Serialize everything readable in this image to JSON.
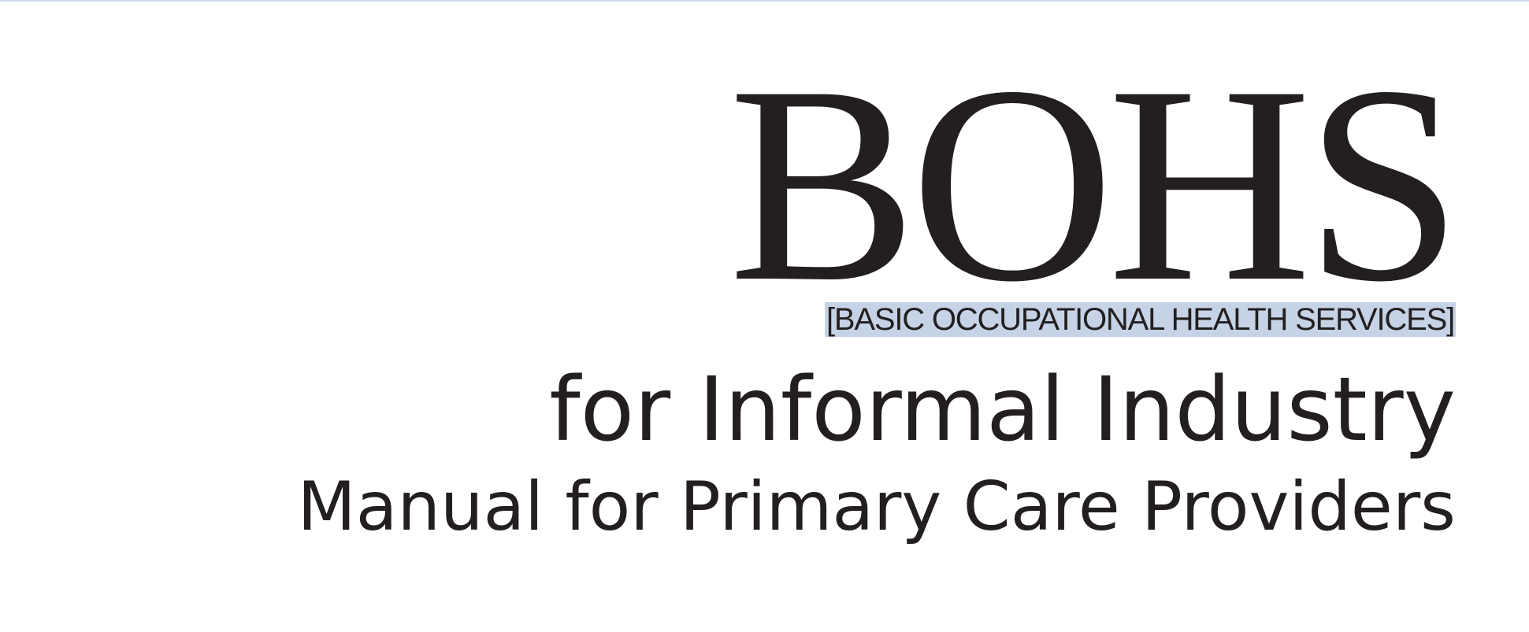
{
  "cover": {
    "acronym": "BOHS",
    "expansion": "[BASIC OCCUPATIONAL HEALTH SERVICES]",
    "subtitle": "for Informal Industry",
    "tagline": "Manual for Primary Care Providers"
  },
  "colors": {
    "text": "#231f20",
    "highlight": "#c6d3e6",
    "background": "#ffffff"
  }
}
